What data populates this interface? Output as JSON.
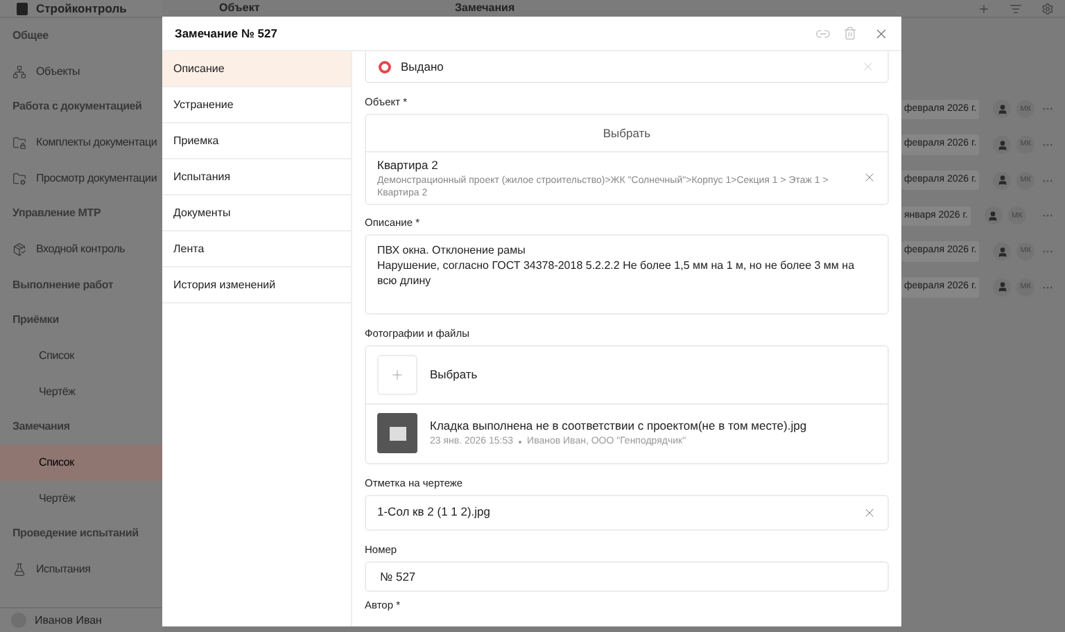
{
  "app": {
    "brand": "Стройконтроль",
    "header_columns": [
      "Объект",
      "Замечания"
    ],
    "sidebar": [
      {
        "kind": "section",
        "label": "Общее"
      },
      {
        "kind": "item",
        "label": "Объекты",
        "selected": false
      },
      {
        "kind": "section",
        "label": "Работа с документацией"
      },
      {
        "kind": "item",
        "label": "Комплекты документаци",
        "selected": false
      },
      {
        "kind": "item",
        "label": "Просмотр документации",
        "selected": false
      },
      {
        "kind": "section",
        "label": "Управление МТР"
      },
      {
        "kind": "item",
        "label": "Входной контроль",
        "selected": false
      },
      {
        "kind": "section",
        "label": "Выполнение работ"
      },
      {
        "kind": "section",
        "label": "Приёмки"
      },
      {
        "kind": "subitem",
        "label": "Список",
        "selected": false
      },
      {
        "kind": "subitem",
        "label": "Чертёж",
        "selected": false
      },
      {
        "kind": "section",
        "label": "Замечания"
      },
      {
        "kind": "subitem",
        "label": "Список",
        "selected": true
      },
      {
        "kind": "subitem",
        "label": "Чертёж",
        "selected": false
      },
      {
        "kind": "section",
        "label": "Проведение испытаний"
      },
      {
        "kind": "item",
        "label": "Испытания",
        "selected": false
      }
    ],
    "user": "Иванов Иван",
    "rows": [
      {
        "date": "февраля 2026 г.",
        "initials": "МК"
      },
      {
        "date": "февраля 2026 г.",
        "initials": "МК"
      },
      {
        "date": "февраля 2026 г.",
        "initials": "МК"
      },
      {
        "date": "января 2026 г.",
        "initials": "МК"
      },
      {
        "date": "февраля 2026 г.",
        "initials": "МК"
      },
      {
        "date": "февраля 2026 г.",
        "initials": "МК"
      }
    ]
  },
  "dialog": {
    "title": "Замечание № 527",
    "tabs": [
      {
        "label": "Описание",
        "selected": true
      },
      {
        "label": "Устранение",
        "selected": false
      },
      {
        "label": "Приемка",
        "selected": false
      },
      {
        "label": "Испытания",
        "selected": false
      },
      {
        "label": "Документы",
        "selected": false
      },
      {
        "label": "Лента",
        "selected": false
      },
      {
        "label": "История изменений",
        "selected": false
      }
    ],
    "status": {
      "label": "Выдано",
      "color": "#e5484d"
    },
    "object": {
      "label": "Объект *",
      "button": "Выбрать",
      "value": "Квартира 2",
      "path": "Демонстрационный проект (жилое строительство)>ЖК \"Солнечный\">Корпус 1>Секция 1 > Этаж 1 > Квартира 2"
    },
    "description": {
      "label": "Описание *",
      "lines": [
        "ПВХ окна. Отклонение рамы",
        "Нарушение, согласно ГОСТ 34378-2018 5.2.2.2 Не более 1,5 мм на 1 м, но не более 3 мм на всю длину"
      ]
    },
    "files": {
      "label": "Фотографии и файлы",
      "button": "Выбрать",
      "items": [
        {
          "name": "Кладка выполнена не в соответствии с проектом(не в том месте).jpg",
          "date": "23 янв. 2026 15:53",
          "author": "Иванов Иван, ООО \"Генподрядчик\""
        }
      ]
    },
    "drawing_mark": {
      "label": "Отметка на чертеже",
      "value": "1-Сол кв 2 (1 1 2).jpg"
    },
    "number": {
      "label": "Номер",
      "value": "№ 527"
    },
    "author": {
      "label": "Автор *"
    }
  }
}
